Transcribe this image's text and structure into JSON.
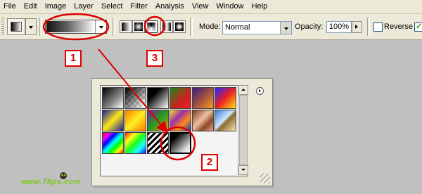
{
  "menu": [
    "File",
    "Edit",
    "Image",
    "Layer",
    "Select",
    "Filter",
    "Analysis",
    "View",
    "Window",
    "Help"
  ],
  "options_bar": {
    "mode_label": "Mode:",
    "mode_value": "Normal",
    "opacity_label": "Opacity:",
    "opacity_value": "100%",
    "reverse_label": "Reverse",
    "reverse_checked": false,
    "dither_checked": true,
    "gradient_types": [
      "linear",
      "radial",
      "angle",
      "reflected",
      "diamond"
    ],
    "selected_gradient_type": "angle"
  },
  "gradient_panel": {
    "presets": [
      [
        "foreground-to-background",
        "foreground-to-transparent",
        "black-white",
        "red-green",
        "violet-orange",
        "blue-red-yellow"
      ],
      [
        "blue-yellow-blue",
        "orange-yellow-orange",
        "violet-green-orange",
        "yellow-violet-orange-blue",
        "copper",
        "chrome"
      ],
      [
        "spectrum",
        "transparent-rainbow",
        "transparent-stripes",
        "black-white-custom"
      ]
    ],
    "selected_preset": "black-white-custom"
  },
  "annotations": {
    "labels": [
      "1",
      "2",
      "3"
    ],
    "color": "#dd0000"
  },
  "watermark": "www.78ps.com",
  "colors": {
    "menu_bg": "#ece9d8",
    "canvas_bg": "#c0c0c0",
    "annotation_red": "#dd0000",
    "watermark_green": "#7cc81a"
  }
}
